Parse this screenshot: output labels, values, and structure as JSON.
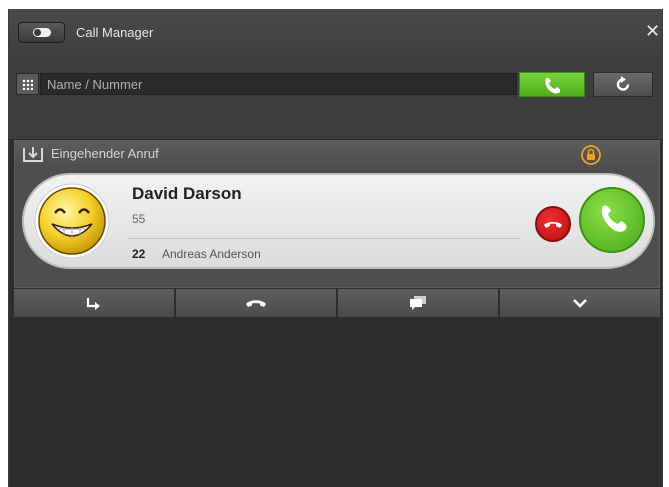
{
  "window": {
    "title": "Call Manager",
    "close_label": "✕"
  },
  "search": {
    "placeholder": "Name / Nummer",
    "value": ""
  },
  "call_panel": {
    "header_title": "Eingehender Anruf",
    "caller_name": "David Darson",
    "caller_number": "55",
    "extension_number": "22",
    "extension_name": "Andreas Anderson"
  },
  "icons": {
    "toggle": "toggle-icon",
    "dialpad": "dialpad-icon",
    "dial": "phone-icon",
    "refresh": "refresh-icon",
    "incoming": "incoming-call-icon",
    "lock": "lock-icon",
    "avatar": "smiley-avatar",
    "reject": "hangup-icon",
    "accept": "phone-icon",
    "forward": "forward-icon",
    "hangup": "hangup-icon",
    "chat": "chat-icon",
    "more": "chevron-down-icon"
  },
  "colors": {
    "accent_green": "#5cbf24",
    "reject_red": "#d41a1a",
    "lock_orange": "#f2a21e",
    "background": "#2e2e2e"
  }
}
